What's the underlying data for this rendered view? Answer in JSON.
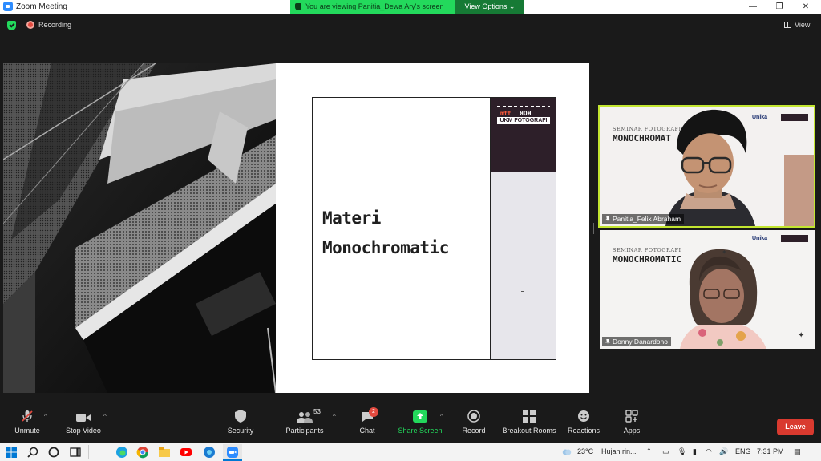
{
  "window": {
    "title": "Zoom Meeting",
    "viewing_banner": "You are viewing Panitia_Dewa Ary's screen",
    "view_options": "View Options",
    "minimize_glyph": "—",
    "restore_glyph": "❐",
    "close_glyph": "✕"
  },
  "meeting": {
    "recording_label": "Recording",
    "view_label": "View"
  },
  "slide": {
    "title_line1": "Materi",
    "title_line2": "Monochromatic",
    "logo_mtf": "mtf",
    "logo_ror": "ROR",
    "logo_org": "UKM FOTOGRAFI"
  },
  "participants_video": [
    {
      "name": "Panitia_Felix Abraham",
      "bg_line1": "SEMINAR FOTOGRAFI",
      "bg_line2": "MONOCHROMAT",
      "logo_text": "Unika"
    },
    {
      "name": "Donny Danardono",
      "bg_line1": "SEMINAR FOTOGRAFI",
      "bg_line2": "MONOCHROMATIC",
      "logo_text": "Unika"
    }
  ],
  "toolbar": {
    "unmute": "Unmute",
    "stop_video": "Stop Video",
    "security": "Security",
    "participants": "Participants",
    "participants_count": "53",
    "chat": "Chat",
    "chat_badge": "2",
    "share_screen": "Share Screen",
    "record": "Record",
    "breakout_rooms": "Breakout Rooms",
    "reactions": "Reactions",
    "apps": "Apps",
    "leave": "Leave",
    "caret_glyph": "^"
  },
  "taskbar": {
    "weather_temp": "23°C",
    "weather_text": "Hujan rin...",
    "language": "ENG",
    "time": "7:31 PM"
  },
  "colors": {
    "zoom_green": "#23d95c",
    "leave_red": "#d93a2f",
    "active_speaker": "#c3e630",
    "dark_bg": "#1a1a1a"
  }
}
